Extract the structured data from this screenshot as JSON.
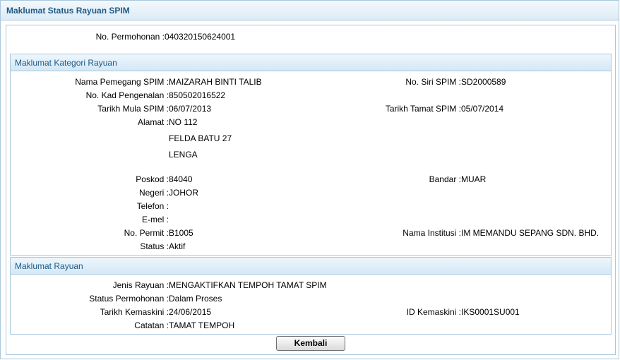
{
  "main_title": "Maklumat Status Rayuan SPIM",
  "permohonan": {
    "label": "No. Permohonan :",
    "value": "040320150624001"
  },
  "kategori": {
    "title": "Maklumat Kategori Rayuan",
    "nama": {
      "label": "Nama Pemegang SPIM :",
      "value": "MAIZARAH BINTI TALIB"
    },
    "no_siri": {
      "label": "No. Siri SPIM :",
      "value": "SD2000589"
    },
    "no_kp": {
      "label": "No. Kad Pengenalan :",
      "value": "850502016522"
    },
    "tarikh_mula": {
      "label": "Tarikh Mula SPIM :",
      "value": "06/07/2013"
    },
    "tarikh_tamat": {
      "label": "Tarikh Tamat SPIM :",
      "value": "05/07/2014"
    },
    "alamat": {
      "label": "Alamat :",
      "line1": "NO 112",
      "line2": "FELDA BATU 27",
      "line3": "LENGA"
    },
    "poskod": {
      "label": "Poskod :",
      "value": "84040"
    },
    "bandar": {
      "label": "Bandar :",
      "value": "MUAR"
    },
    "negeri": {
      "label": "Negeri :",
      "value": "JOHOR"
    },
    "telefon": {
      "label": "Telefon :",
      "value": ""
    },
    "emel": {
      "label": "E-mel :",
      "value": ""
    },
    "no_permit": {
      "label": "No. Permit :",
      "value": "B1005"
    },
    "nama_institusi": {
      "label": "Nama Institusi :",
      "value": "IM MEMANDU SEPANG SDN. BHD."
    },
    "status": {
      "label": "Status :",
      "value": "Aktif"
    }
  },
  "rayuan": {
    "title": "Maklumat Rayuan",
    "jenis": {
      "label": "Jenis Rayuan :",
      "value": "MENGAKTIFKAN TEMPOH TAMAT SPIM"
    },
    "status_permohonan": {
      "label": "Status Permohonan :",
      "value": "Dalam Proses"
    },
    "tarikh_kemaskini": {
      "label": "Tarikh Kemaskini :",
      "value": "24/06/2015"
    },
    "id_kemaskini": {
      "label": "ID Kemaskini :",
      "value": "IKS0001SU001"
    },
    "catatan": {
      "label": "Catatan :",
      "value": "TAMAT TEMPOH"
    }
  },
  "buttons": {
    "kembali": "Kembali"
  }
}
